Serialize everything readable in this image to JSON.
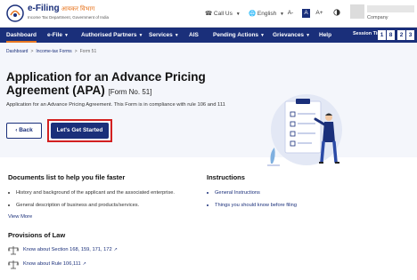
{
  "header": {
    "logo_title": "e-Filing",
    "logo_hindi": "आयकर विभाग",
    "logo_sub": "Income Tax Department, Government of India",
    "call_us": "Call Us",
    "language": "English",
    "font_small": "A-",
    "font_normal": "A",
    "font_large": "A+",
    "company": "Company"
  },
  "nav": {
    "items": [
      "Dashboard",
      "e-File",
      "Authorised Partners",
      "Services",
      "AIS",
      "Pending Actions",
      "Grievances",
      "Help"
    ],
    "active": "Dashboard",
    "session_label": "Session Time",
    "session_digits": [
      "1",
      "8",
      "2",
      "3"
    ]
  },
  "hero": {
    "breadcrumb": [
      "Dashboard",
      "Income-tax Forms",
      "Form 51"
    ],
    "title": "Application for an Advance Pricing Agreement (APA)",
    "form_no": "[Form No. 51]",
    "description": "Application for an Advance Pricing Agreement. This Form is in compliance with rule 106 and 111",
    "back_label": "Back",
    "start_label": "Let's Get Started"
  },
  "documents": {
    "title": "Documents list to help you file faster",
    "items": [
      "History and background of the applicant and the associated enterprise.",
      "General description of business and products/services."
    ],
    "view_more": "View More"
  },
  "provisions": {
    "title": "Provisions of Law",
    "items": [
      "Know about Section 168, 159, 171, 172",
      "Know about Rule 106,111"
    ]
  },
  "instructions": {
    "title": "Instructions",
    "items": [
      "General Instructions",
      "Things you should know before filing"
    ]
  },
  "colors": {
    "primary": "#1a2f7a",
    "accent": "#e87722",
    "highlight": "#d32020",
    "hero_bg": "#f4f6fb"
  }
}
